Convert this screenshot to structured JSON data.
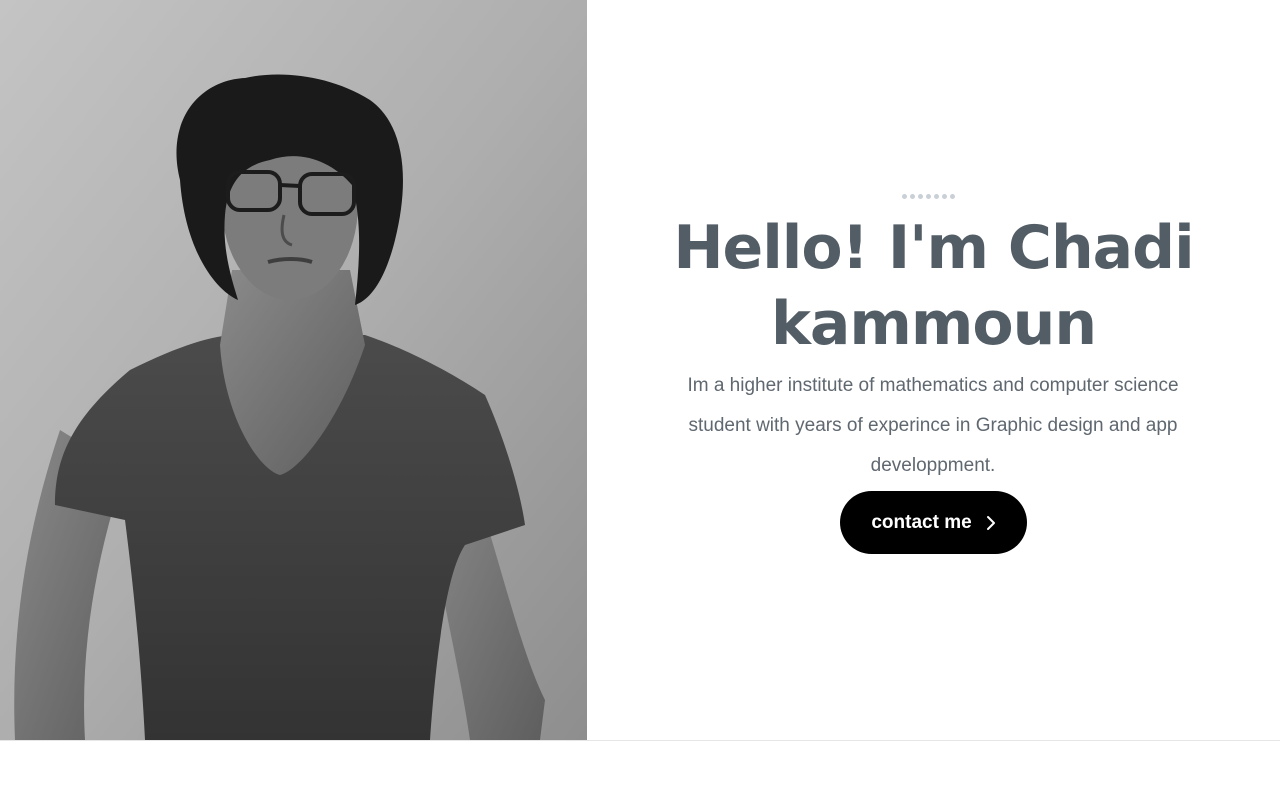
{
  "hero": {
    "photo_alt": "Portrait photo",
    "headline": "Hello! I'm Chadi kammoun",
    "bio": "Im a higher institute of mathematics and computer science student with years of experince in Graphic design and app developpment.",
    "contact_label": "contact me",
    "contact_icon": "chevron-right-icon"
  },
  "colors": {
    "heading": "#535d66",
    "text": "#5f6870",
    "button_bg": "#000000",
    "button_text": "#ffffff",
    "dots": "#c9d0d6"
  }
}
